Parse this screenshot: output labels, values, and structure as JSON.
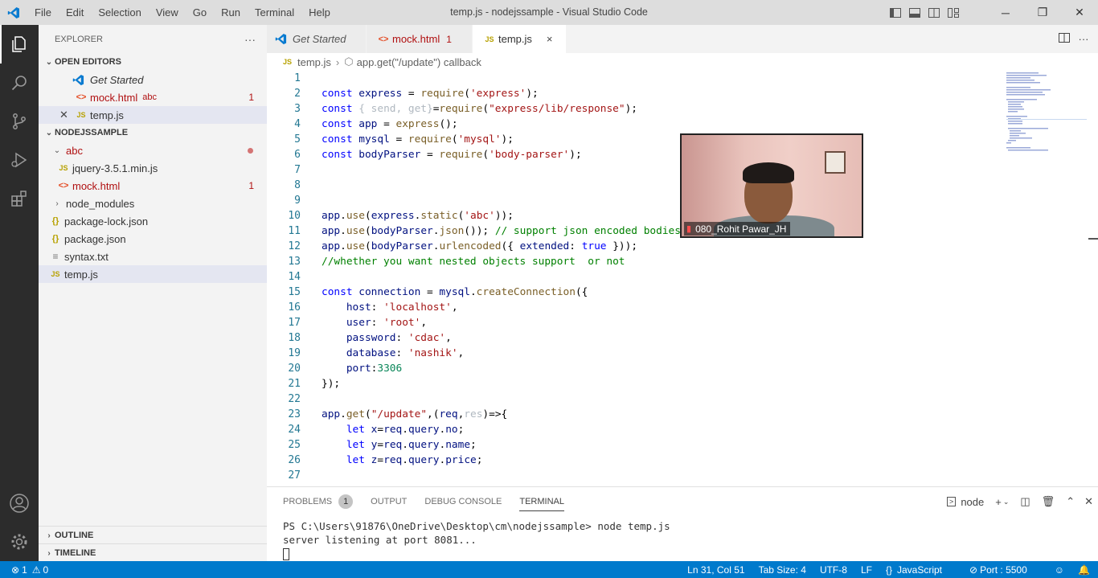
{
  "window": {
    "title": "temp.js - nodejssample - Visual Studio Code",
    "menu": [
      "File",
      "Edit",
      "Selection",
      "View",
      "Go",
      "Run",
      "Terminal",
      "Help"
    ]
  },
  "sidebar": {
    "header": "EXPLORER",
    "open_editors": {
      "title": "OPEN EDITORS",
      "items": [
        {
          "label": "Get Started",
          "type": "vscode"
        },
        {
          "label": "mock.html",
          "folder": "abc",
          "badge": "1",
          "type": "html"
        },
        {
          "label": "temp.js",
          "type": "js"
        }
      ]
    },
    "project": {
      "title": "NODEJSSAMPLE",
      "items": [
        {
          "label": "abc",
          "type": "folder-open"
        },
        {
          "label": "jquery-3.5.1.min.js",
          "type": "js"
        },
        {
          "label": "mock.html",
          "badge": "1",
          "type": "html"
        },
        {
          "label": "node_modules",
          "type": "folder"
        },
        {
          "label": "package-lock.json",
          "type": "json"
        },
        {
          "label": "package.json",
          "type": "json"
        },
        {
          "label": "syntax.txt",
          "type": "txt"
        },
        {
          "label": "temp.js",
          "type": "js"
        }
      ]
    },
    "outline": "OUTLINE",
    "timeline": "TIMELINE"
  },
  "tabs": [
    {
      "label": "Get Started"
    },
    {
      "label": "mock.html",
      "badge": "1"
    },
    {
      "label": "temp.js",
      "close": "×"
    }
  ],
  "breadcrumb": {
    "file": "temp.js",
    "symbol": "app.get(\"/update\") callback"
  },
  "editor": {
    "line_numbers": [
      "1",
      "2",
      "3",
      "4",
      "5",
      "6",
      "7",
      "8",
      "9",
      "10",
      "11",
      "12",
      "13",
      "14",
      "15",
      "16",
      "17",
      "18",
      "19",
      "20",
      "21",
      "22",
      "23",
      "24",
      "25",
      "26",
      "27"
    ]
  },
  "video": {
    "participant": "080_Rohit Pawar_JH"
  },
  "panel": {
    "tabs": [
      "PROBLEMS",
      "OUTPUT",
      "DEBUG CONSOLE",
      "TERMINAL"
    ],
    "problems_count": "1",
    "terminal_name": "node",
    "terminal_lines": [
      "PS C:\\Users\\91876\\OneDrive\\Desktop\\cm\\nodejssample> node temp.js",
      "server listening at port 8081..."
    ]
  },
  "statusbar": {
    "errors": "1",
    "warnings": "0",
    "position": "Ln 31, Col 51",
    "tab_size": "Tab Size: 4",
    "encoding": "UTF-8",
    "eol": "LF",
    "language": "JavaScript",
    "port": "Port : 5500"
  },
  "colors": {
    "accent": "#007acc",
    "activity_bar": "#2c2c2c",
    "sidebar": "#f3f3f3",
    "title_bar": "#dddddd"
  }
}
